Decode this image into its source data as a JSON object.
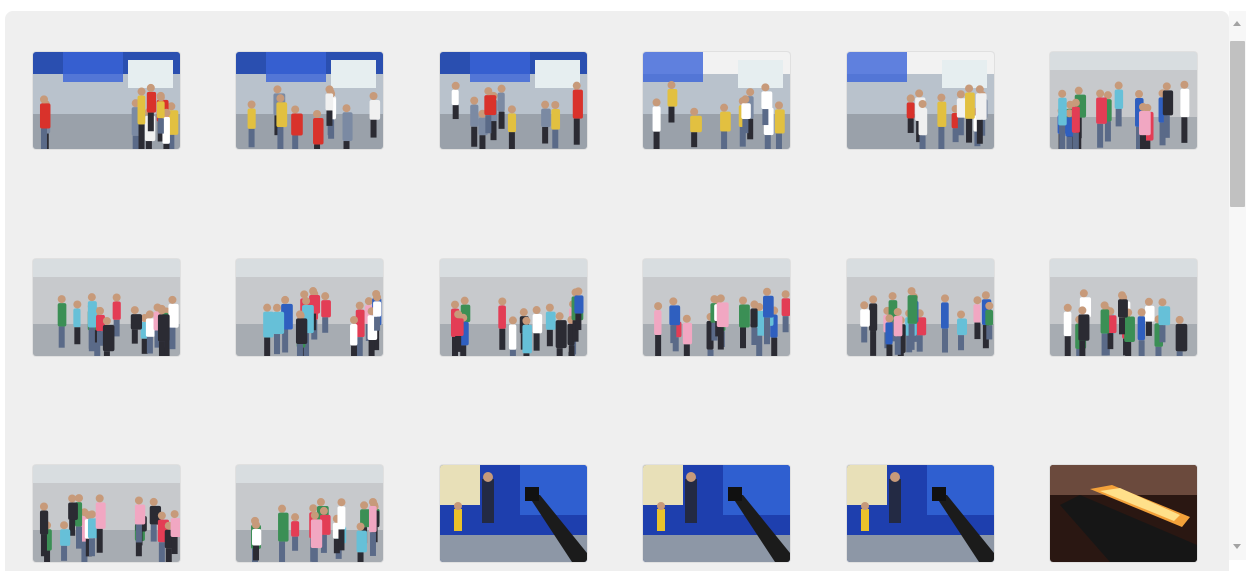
{
  "gallery": {
    "thumbnails": [
      {
        "scene": "crowd-blue-tent"
      },
      {
        "scene": "crowd-blue-tent"
      },
      {
        "scene": "crowd-blue-tent"
      },
      {
        "scene": "crowd-white-tent"
      },
      {
        "scene": "crowd-white-tent"
      },
      {
        "scene": "crowd-colorful"
      },
      {
        "scene": "crowd-colorful"
      },
      {
        "scene": "crowd-colorful"
      },
      {
        "scene": "crowd-colorful"
      },
      {
        "scene": "crowd-colorful"
      },
      {
        "scene": "crowd-colorful"
      },
      {
        "scene": "crowd-colorful"
      },
      {
        "scene": "crowd-colorful"
      },
      {
        "scene": "crowd-colorful"
      },
      {
        "scene": "stage-blue"
      },
      {
        "scene": "stage-blue"
      },
      {
        "scene": "stage-blue"
      },
      {
        "scene": "fire-closeup"
      }
    ]
  },
  "colors": {
    "background": "#efefef",
    "scrollbar_thumb": "#c1c1c1"
  },
  "scrollbar": {
    "icons": [
      "scroll-up-arrow-icon",
      "scroll-down-arrow-icon"
    ]
  }
}
